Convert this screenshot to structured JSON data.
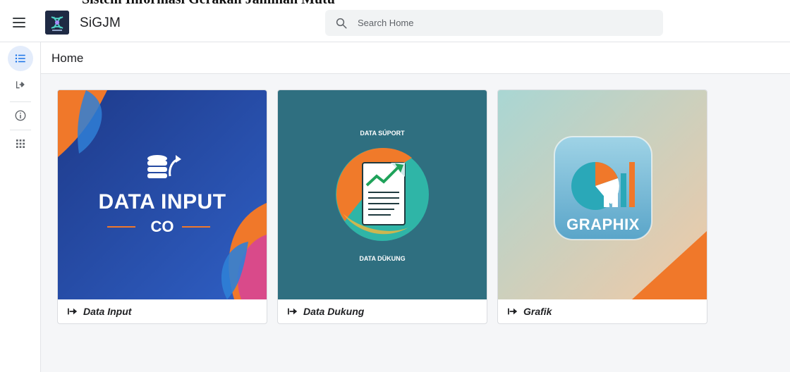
{
  "header": {
    "app_title": "SiGJM",
    "search_placeholder": "Search Home"
  },
  "top_strip": {
    "text": "Sistem Informasi Gerakan Jaminan Mutu"
  },
  "rail": {
    "items": [
      {
        "icon": "list-icon",
        "active": true
      },
      {
        "icon": "logout-icon",
        "active": false
      },
      {
        "icon": "info-icon",
        "active": false
      },
      {
        "icon": "apps-grid-icon",
        "active": false
      }
    ]
  },
  "breadcrumb": {
    "title": "Home"
  },
  "cards": [
    {
      "label": "Data Input",
      "image_title": "DATA INPUT",
      "image_subtitle": "CO",
      "colors": {
        "bg_start": "#1e3a8a",
        "bg_end": "#2f5fc4",
        "accent": "#f0782a"
      }
    },
    {
      "label": "Data Dukung",
      "image_top_text": "DATA SÚPORT",
      "image_bottom_text": "DATA DÜKUNG",
      "colors": {
        "bg": "#2f6f80",
        "circle_a": "#f07a2a",
        "circle_b": "#2fb5a7"
      }
    },
    {
      "label": "Grafik",
      "image_title": "GRAPHIX",
      "colors": {
        "bg_start": "#a9d6d3",
        "bg_end": "#f1c9a6",
        "accent": "#f0782a",
        "teal": "#2aa8b8"
      }
    }
  ]
}
